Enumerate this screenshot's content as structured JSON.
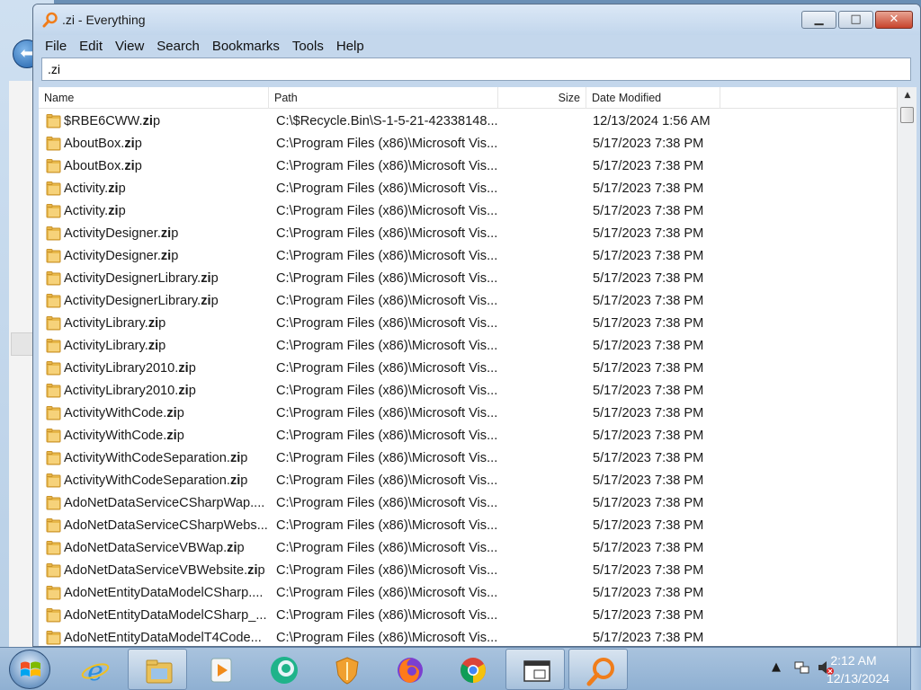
{
  "window": {
    "title": ".zi - Everything",
    "buttons": {
      "minimize": "▁",
      "maximize": "□",
      "close": "✕"
    }
  },
  "menu": [
    "File",
    "Edit",
    "View",
    "Search",
    "Bookmarks",
    "Tools",
    "Help"
  ],
  "search": {
    "value": ".zi"
  },
  "columns": {
    "name": "Name",
    "path": "Path",
    "size": "Size",
    "date": "Date Modified"
  },
  "rows": [
    {
      "pre": "$RBE6CWW.",
      "hl": "zi",
      "post": "p",
      "path": "C:\\$Recycle.Bin\\S-1-5-21-42338148...",
      "date": "12/13/2024 1:56 AM"
    },
    {
      "pre": "AboutBox.",
      "hl": "zi",
      "post": "p",
      "path": "C:\\Program Files (x86)\\Microsoft Vis...",
      "date": "5/17/2023 7:38 PM"
    },
    {
      "pre": "AboutBox.",
      "hl": "zi",
      "post": "p",
      "path": "C:\\Program Files (x86)\\Microsoft Vis...",
      "date": "5/17/2023 7:38 PM"
    },
    {
      "pre": "Activity.",
      "hl": "zi",
      "post": "p",
      "path": "C:\\Program Files (x86)\\Microsoft Vis...",
      "date": "5/17/2023 7:38 PM"
    },
    {
      "pre": "Activity.",
      "hl": "zi",
      "post": "p",
      "path": "C:\\Program Files (x86)\\Microsoft Vis...",
      "date": "5/17/2023 7:38 PM"
    },
    {
      "pre": "ActivityDesigner.",
      "hl": "zi",
      "post": "p",
      "path": "C:\\Program Files (x86)\\Microsoft Vis...",
      "date": "5/17/2023 7:38 PM"
    },
    {
      "pre": "ActivityDesigner.",
      "hl": "zi",
      "post": "p",
      "path": "C:\\Program Files (x86)\\Microsoft Vis...",
      "date": "5/17/2023 7:38 PM"
    },
    {
      "pre": "ActivityDesignerLibrary.",
      "hl": "zi",
      "post": "p",
      "path": "C:\\Program Files (x86)\\Microsoft Vis...",
      "date": "5/17/2023 7:38 PM"
    },
    {
      "pre": "ActivityDesignerLibrary.",
      "hl": "zi",
      "post": "p",
      "path": "C:\\Program Files (x86)\\Microsoft Vis...",
      "date": "5/17/2023 7:38 PM"
    },
    {
      "pre": "ActivityLibrary.",
      "hl": "zi",
      "post": "p",
      "path": "C:\\Program Files (x86)\\Microsoft Vis...",
      "date": "5/17/2023 7:38 PM"
    },
    {
      "pre": "ActivityLibrary.",
      "hl": "zi",
      "post": "p",
      "path": "C:\\Program Files (x86)\\Microsoft Vis...",
      "date": "5/17/2023 7:38 PM"
    },
    {
      "pre": "ActivityLibrary2010.",
      "hl": "zi",
      "post": "p",
      "path": "C:\\Program Files (x86)\\Microsoft Vis...",
      "date": "5/17/2023 7:38 PM"
    },
    {
      "pre": "ActivityLibrary2010.",
      "hl": "zi",
      "post": "p",
      "path": "C:\\Program Files (x86)\\Microsoft Vis...",
      "date": "5/17/2023 7:38 PM"
    },
    {
      "pre": "ActivityWithCode.",
      "hl": "zi",
      "post": "p",
      "path": "C:\\Program Files (x86)\\Microsoft Vis...",
      "date": "5/17/2023 7:38 PM"
    },
    {
      "pre": "ActivityWithCode.",
      "hl": "zi",
      "post": "p",
      "path": "C:\\Program Files (x86)\\Microsoft Vis...",
      "date": "5/17/2023 7:38 PM"
    },
    {
      "pre": "ActivityWithCodeSeparation.",
      "hl": "zi",
      "post": "p",
      "path": "C:\\Program Files (x86)\\Microsoft Vis...",
      "date": "5/17/2023 7:38 PM"
    },
    {
      "pre": "ActivityWithCodeSeparation.",
      "hl": "zi",
      "post": "p",
      "path": "C:\\Program Files (x86)\\Microsoft Vis...",
      "date": "5/17/2023 7:38 PM"
    },
    {
      "pre": "AdoNetDataServiceCSharpWap....",
      "hl": "",
      "post": "",
      "path": "C:\\Program Files (x86)\\Microsoft Vis...",
      "date": "5/17/2023 7:38 PM"
    },
    {
      "pre": "AdoNetDataServiceCSharpWebs...",
      "hl": "",
      "post": "",
      "path": "C:\\Program Files (x86)\\Microsoft Vis...",
      "date": "5/17/2023 7:38 PM"
    },
    {
      "pre": "AdoNetDataServiceVBWap.",
      "hl": "zi",
      "post": "p",
      "path": "C:\\Program Files (x86)\\Microsoft Vis...",
      "date": "5/17/2023 7:38 PM"
    },
    {
      "pre": "AdoNetDataServiceVBWebsite.",
      "hl": "zi",
      "post": "p",
      "path": "C:\\Program Files (x86)\\Microsoft Vis...",
      "date": "5/17/2023 7:38 PM"
    },
    {
      "pre": "AdoNetEntityDataModelCSharp....",
      "hl": "",
      "post": "",
      "path": "C:\\Program Files (x86)\\Microsoft Vis...",
      "date": "5/17/2023 7:38 PM"
    },
    {
      "pre": "AdoNetEntityDataModelCSharp_...",
      "hl": "",
      "post": "",
      "path": "C:\\Program Files (x86)\\Microsoft Vis...",
      "date": "5/17/2023 7:38 PM"
    },
    {
      "pre": "AdoNetEntityDataModelT4Code...",
      "hl": "",
      "post": "",
      "path": "C:\\Program Files (x86)\\Microsoft Vis...",
      "date": "5/17/2023 7:38 PM"
    }
  ],
  "taskbar": {
    "apps": [
      "start",
      "internet-explorer",
      "windows-explorer",
      "media-player",
      "chat-app",
      "security-shield",
      "firefox",
      "chrome",
      "window-switcher",
      "everything-search"
    ],
    "clock_time": "2:12 AM",
    "clock_date": "12/13/2024"
  },
  "colors": {
    "folder": "#e8b84a",
    "folder_dark": "#c9922a",
    "accent": "#3a6ea5"
  }
}
